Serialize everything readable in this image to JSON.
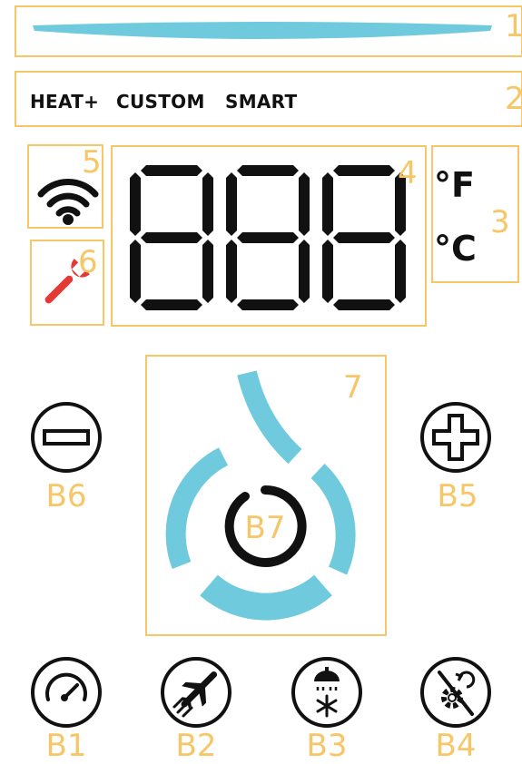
{
  "colors": {
    "accent": "#6ecadc",
    "frame": "#f6c667",
    "segment": "#111111",
    "wrench": "#e53935"
  },
  "regions": {
    "r1": "1",
    "r2": "2",
    "r3": "3",
    "r4": "4",
    "r5": "5",
    "r6": "6",
    "r7": "7"
  },
  "modes": [
    "HEAT+",
    "CUSTOM",
    "SMART"
  ],
  "units": {
    "fahrenheit": "°F",
    "celsius": "°C"
  },
  "icons": {
    "status_bar": "status-bar-icon",
    "wifi": "wifi-icon",
    "service": "wrench-icon",
    "flow_ring": "flow-ring-icon",
    "minus": "minus-icon",
    "plus": "plus-icon",
    "speed": "gauge-icon",
    "vacation": "airplane-icon",
    "cold_shower": "cold-shower-icon",
    "no_settings": "gear-off-icon"
  },
  "buttons": {
    "b1": "B1",
    "b2": "B2",
    "b3": "B3",
    "b4": "B4",
    "b5": "B5",
    "b6": "B6",
    "b7": "B7"
  }
}
